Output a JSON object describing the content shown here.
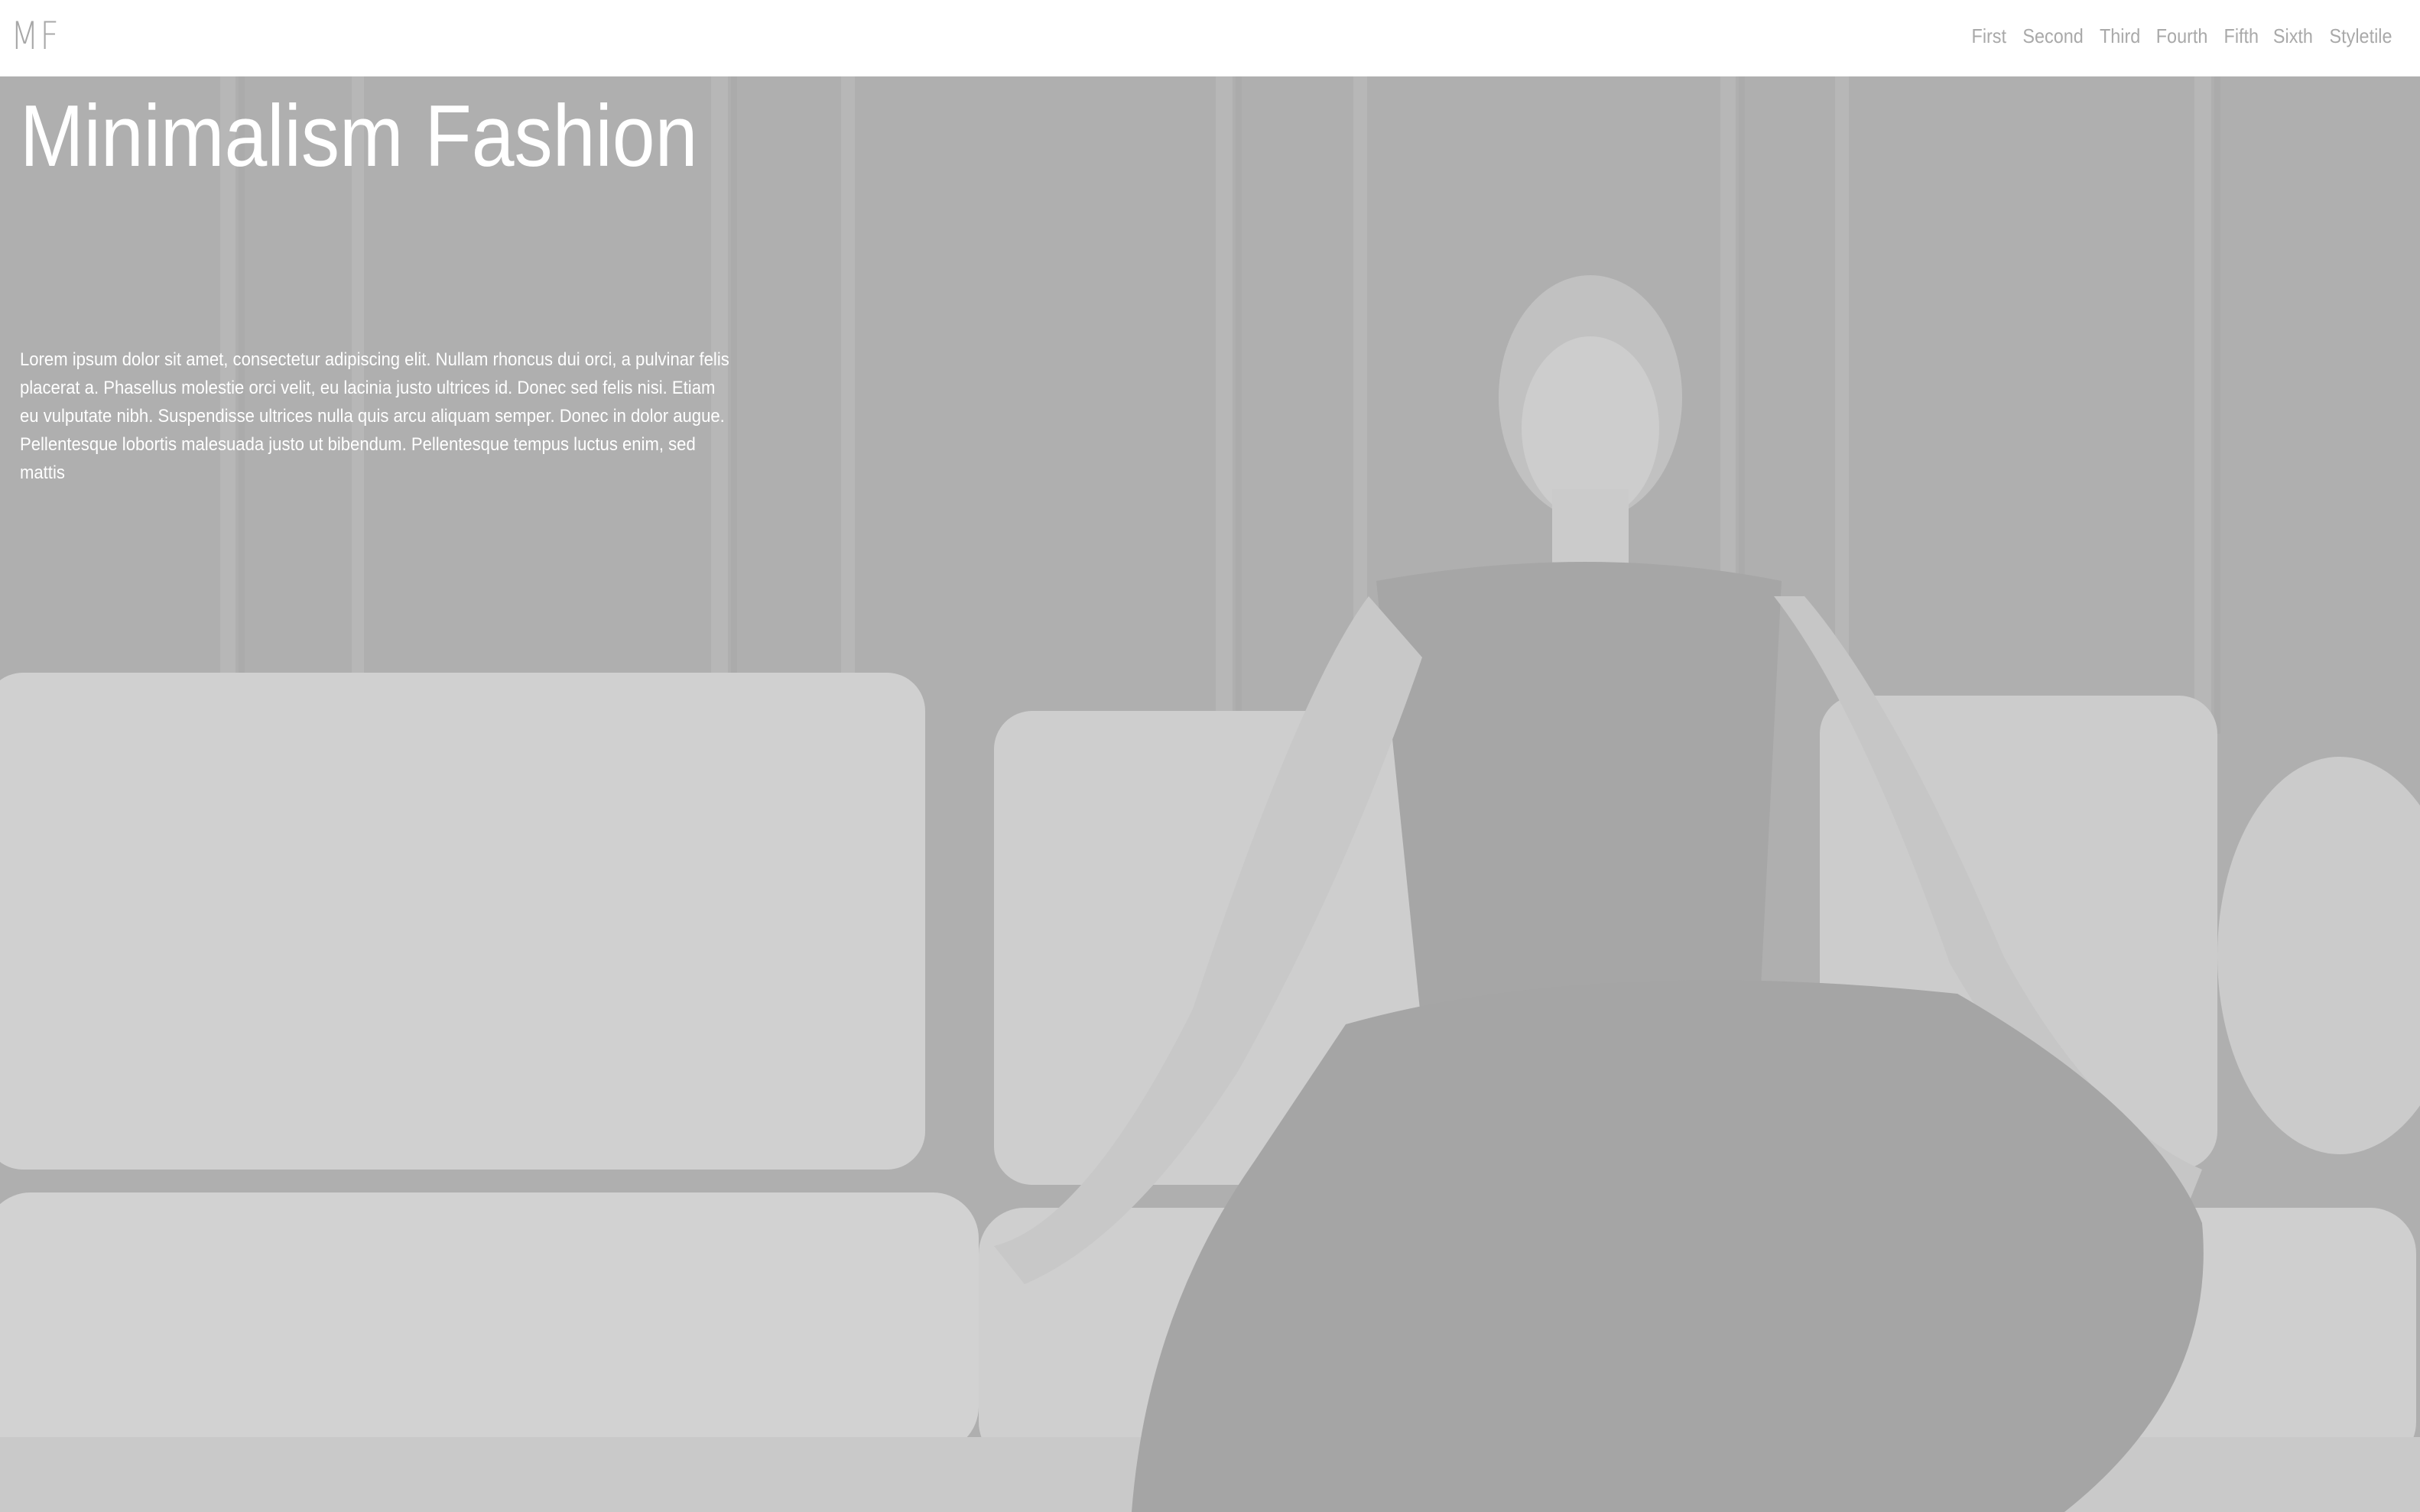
{
  "header": {
    "logo": "MF",
    "nav": [
      {
        "label": "First"
      },
      {
        "label": "Second"
      },
      {
        "label": "Third"
      },
      {
        "label": "Fourth"
      },
      {
        "label": "Fifth"
      },
      {
        "label": "Sixth"
      },
      {
        "label": "Styletile"
      }
    ]
  },
  "hero": {
    "title": "Minimalism Fashion",
    "body": "Lorem ipsum dolor sit amet, consectetur adipiscing elit. Nullam rhoncus dui orci, a pulvinar felis placerat a. Phasellus molestie orci velit, eu lacinia justo ultrices id. Donec sed felis nisi. Etiam eu vulputate nibh. Suspendisse ultrices nulla quis arcu aliquam semper. Donec in dolor augue. Pellentesque lobortis malesuada justo ut bibendum. Pellentesque tempus luctus enim, sed mattis"
  },
  "colors": {
    "header_bg": "#ffffff",
    "nav_text": "#a9a9a9",
    "overlay": "#b3b3b3",
    "hero_text": "#ffffff"
  }
}
